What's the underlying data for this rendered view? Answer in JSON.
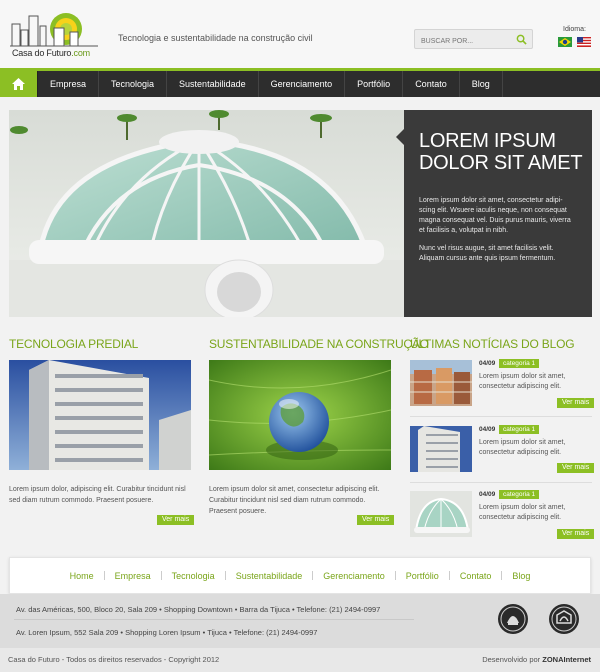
{
  "header": {
    "logo_text_part1": "Casa do Futuro",
    "logo_text_part2": ".com",
    "tagline": "Tecnologia e sustentabilidade na construção civil",
    "search_placeholder": "BUSCAR POR...",
    "language_label": "Idioma:",
    "language_flags": [
      "brazil-flag",
      "usa-flag"
    ]
  },
  "nav": {
    "items": [
      "Empresa",
      "Tecnologia",
      "Sustentabilidade",
      "Gerenciamento",
      "Portfólio",
      "Contato",
      "Blog"
    ]
  },
  "hero": {
    "title": "LOREM IPSUM DOLOR SIT AMET",
    "text1": "Lorem ipsum dolor sit amet, consectetur adipi-scing elit. Wsuere iaculis neque, non consequat magna consequat vel. Duis purus mauris, viverra et facilisis a, volutpat in nibh.",
    "text2": "Nunc vel risus augue, sit amet facilisis velit. Aliquam cursus ante quis ipsum fermentum."
  },
  "columns": [
    {
      "title": "TECNOLOGIA PREDIAL",
      "text": "Lorem ipsum dolor, adipiscing elit. Curabitur tincidunt nisl sed diam rutrum commodo. Praesent posuere.",
      "more": "Ver mais"
    },
    {
      "title": "SUSTENTABILIDADE NA CONSTRUÇÃO",
      "text": "Lorem ipsum dolor sit amet, consectetur adipiscing elit. Curabitur tincidunt nisl sed diam rutrum commodo. Praesent posuere.",
      "more": "Ver mais"
    }
  ],
  "blog": {
    "title": "ÚLTIMAS NOTÍCIAS DO BLOG",
    "items": [
      {
        "date": "04/09",
        "category": "categoria 1",
        "text": "Lorem ipsum dolor sit amet, consectetur adipiscing elit.",
        "more": "Ver mais"
      },
      {
        "date": "04/09",
        "category": "categoria 1",
        "text": "Lorem ipsum dolor sit amet, consectetur adipiscing elit.",
        "more": "Ver mais"
      },
      {
        "date": "04/09",
        "category": "categoria 1",
        "text": "Lorem ipsum dolor sit amet, consectetur adipiscing elit.",
        "more": "Ver mais"
      }
    ]
  },
  "footer": {
    "nav": [
      "Home",
      "Empresa",
      "Tecnologia",
      "Sustentabilidade",
      "Gerenciamento",
      "Portfólio",
      "Contato",
      "Blog"
    ],
    "address1": "Av. das Américas, 500, Bloco 20, Sala 209 • Shopping Downtown • Barra da Tijuca • Telefone: (21) 2494-0997",
    "address2": "Av. Loren Ipsum, 552 Sala 209 • Shopping Loren Ipsum • Tijuca • Telefone: (21) 2494-0997",
    "copyright": "Casa do Futuro - Todos os direitos reservados - Copyright 2012",
    "developed_by_label": "Desenvolvido por",
    "developed_by": "ZONAInternet"
  },
  "colors": {
    "accent": "#8cbf24",
    "nav_bg": "#2d2d2d",
    "panel_bg": "#3a3a3a"
  }
}
